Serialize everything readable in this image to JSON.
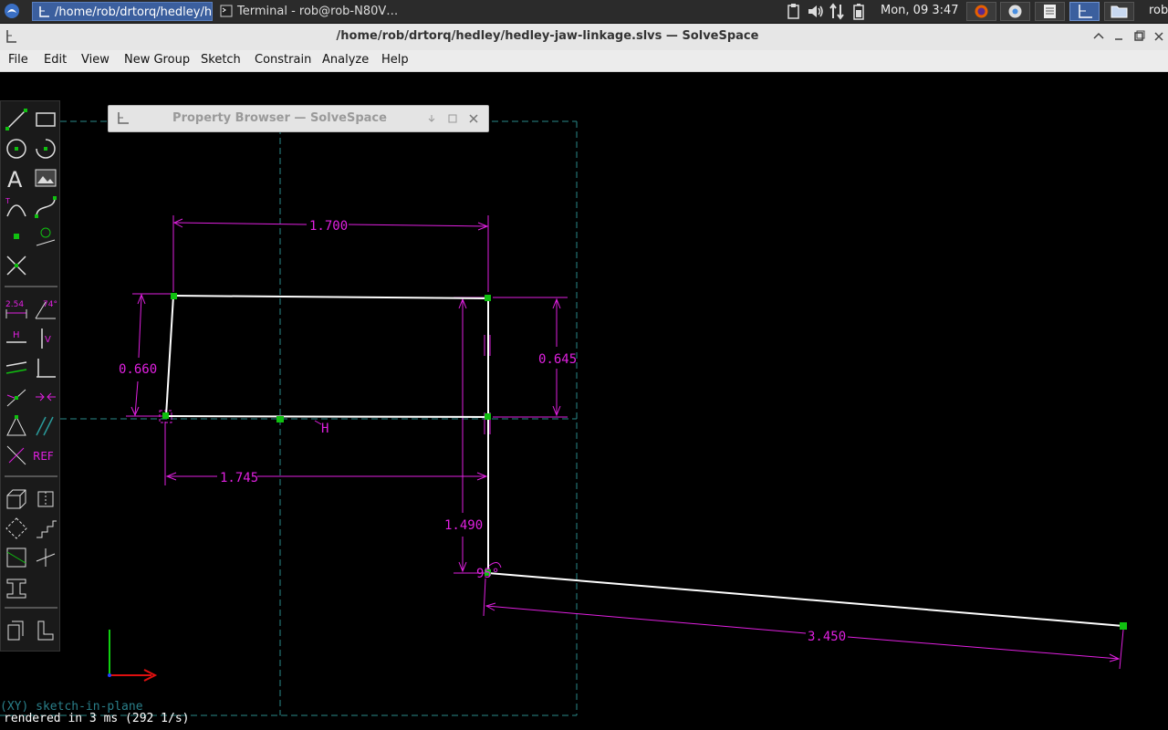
{
  "taskbar": {
    "window_1": "/home/rob/drtorq/hedley/he…",
    "window_2": "Terminal - rob@rob-N80V…",
    "clock": "Mon, 09  3:47",
    "user": "rob"
  },
  "window": {
    "title": "/home/rob/drtorq/hedley/hedley-jaw-linkage.slvs — SolveSpace"
  },
  "menu": {
    "file": "File",
    "edit": "Edit",
    "view": "View",
    "new_group": "New Group",
    "sketch": "Sketch",
    "constrain": "Constrain",
    "analyze": "Analyze",
    "help": "Help"
  },
  "property_browser": {
    "title": "Property Browser — SolveSpace"
  },
  "toolbar": {
    "dim_length": "2.54",
    "dim_angle": "74°",
    "horizontal": "H",
    "vertical": "V",
    "reference": "REF"
  },
  "sketch": {
    "dim_top": "1.700",
    "dim_left": "0.660",
    "dim_right": "0.645",
    "dim_bottom": "1.745",
    "dim_vertical": "1.490",
    "dim_angle": "95°",
    "dim_long": "3.450",
    "constraint_h": "H",
    "plane_label": "(XY) sketch-in-plane"
  },
  "status": {
    "render": "rendered in 3 ms (292 1/s)"
  },
  "colors": {
    "constraint": "#e020e0",
    "entity": "#ffffff",
    "point": "#10c010",
    "workplane": "#2a8a8a",
    "accent": "#3b5f9e"
  }
}
